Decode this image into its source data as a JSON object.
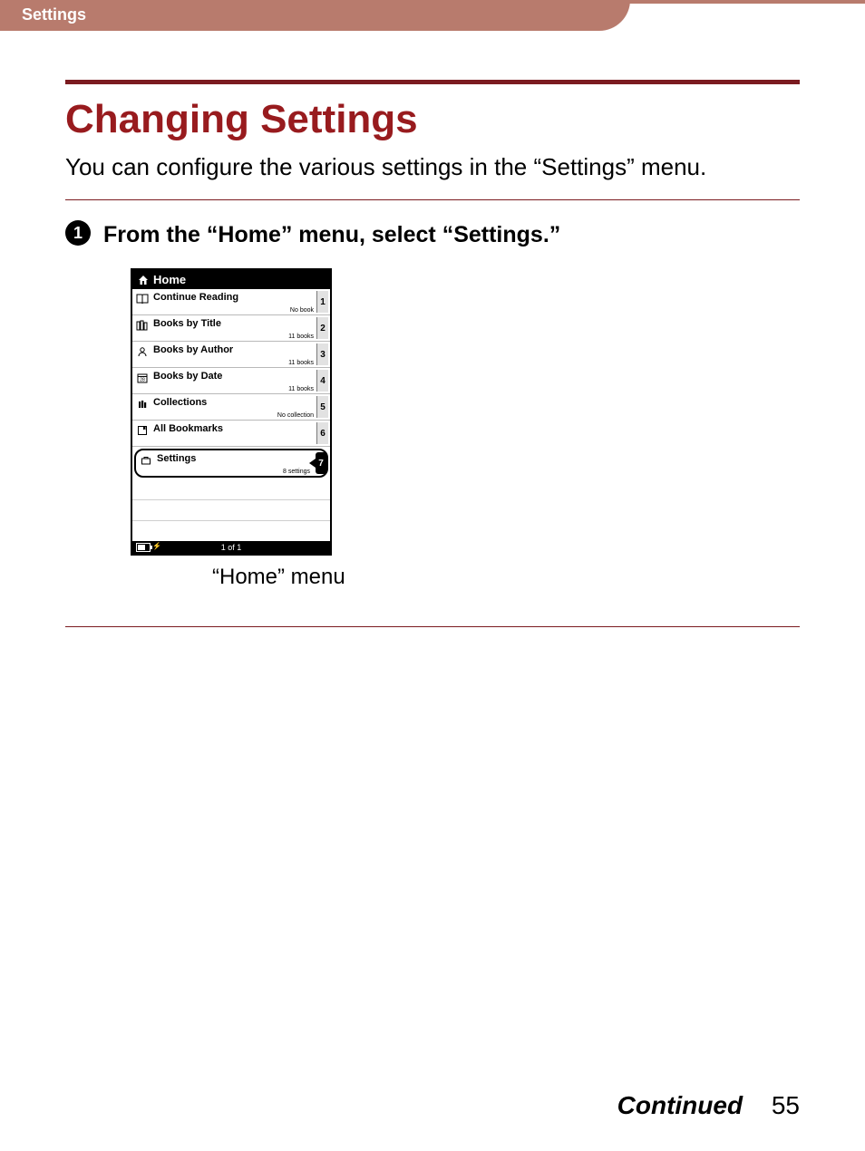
{
  "header": {
    "section_label": "Settings"
  },
  "title": "Changing Settings",
  "intro": "You can configure the various settings in the “Settings” menu.",
  "step": {
    "number": "1",
    "text": "From the “Home” menu, select “Settings.”"
  },
  "device": {
    "title": "Home",
    "rows": [
      {
        "label": "Continue Reading",
        "sub": "No book",
        "num": "1",
        "icon": "book-open"
      },
      {
        "label": "Books by Title",
        "sub": "11 books",
        "num": "2",
        "icon": "books"
      },
      {
        "label": "Books by Author",
        "sub": "11 books",
        "num": "3",
        "icon": "person"
      },
      {
        "label": "Books by Date",
        "sub": "11 books",
        "num": "4",
        "icon": "calendar"
      },
      {
        "label": "Collections",
        "sub": "No collection",
        "num": "5",
        "icon": "stack"
      },
      {
        "label": "All Bookmarks",
        "sub": "",
        "num": "6",
        "icon": "bookmark"
      },
      {
        "label": "Settings",
        "sub": "8 settings",
        "num": "7",
        "icon": "toolbox",
        "selected": true
      }
    ],
    "footer_page": "1 of 1"
  },
  "caption": "“Home” menu",
  "footer": {
    "continued": "Continued",
    "page": "55"
  }
}
